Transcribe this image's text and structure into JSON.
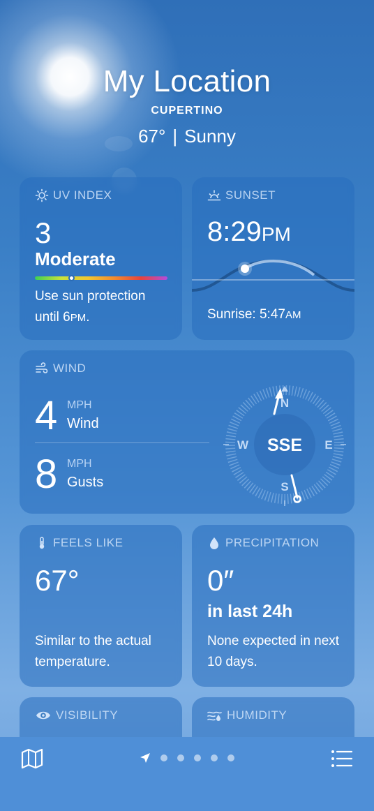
{
  "header": {
    "title": "My Location",
    "city": "CUPERTINO",
    "temp": "67°",
    "separator": "|",
    "condition": "Sunny"
  },
  "uv": {
    "label": "UV INDEX",
    "value": "3",
    "level": "Moderate",
    "desc_line1": "Use sun protection",
    "desc_line2_prefix": "until 6",
    "desc_line2_ampm": "PM",
    "desc_line2_suffix": "."
  },
  "sunset": {
    "label": "SUNSET",
    "time": "8:29",
    "ampm": "PM",
    "sunrise_label": "Sunrise: 5:47",
    "sunrise_ampm": "AM"
  },
  "wind": {
    "label": "WIND",
    "speed": "4",
    "speed_unit": "MPH",
    "speed_label": "Wind",
    "gusts": "8",
    "gusts_unit": "MPH",
    "gusts_label": "Gusts",
    "direction": "SSE",
    "compass": {
      "n": "N",
      "e": "E",
      "s": "S",
      "w": "W"
    }
  },
  "feels_like": {
    "label": "FEELS LIKE",
    "value": "67°",
    "desc": "Similar to the actual temperature."
  },
  "precipitation": {
    "label": "PRECIPITATION",
    "value": "0″",
    "sub": "in last 24h",
    "desc": "None expected in next 10 days."
  },
  "visibility": {
    "label": "VISIBILITY"
  },
  "humidity": {
    "label": "HUMIDITY"
  },
  "colors": {
    "card_bg": "#2e6fb8",
    "accent_label": "#d2e4fa",
    "bottom_bar": "#4f8fd7"
  },
  "icons": [
    "sun-icon",
    "sunset-icon",
    "wind-icon",
    "thermometer-icon",
    "drop-icon",
    "eye-icon",
    "humidity-icon",
    "map-icon",
    "location-arrow-icon",
    "list-icon"
  ]
}
